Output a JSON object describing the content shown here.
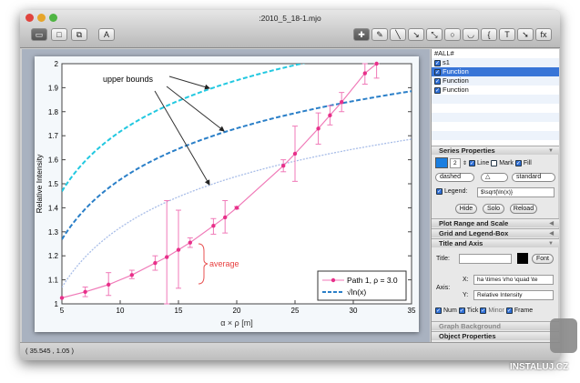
{
  "window": {
    "title": ":2010_5_18-1.mjo"
  },
  "toolbar": {
    "left": [
      {
        "name": "view-page",
        "glyph": "▭"
      },
      {
        "name": "view-graph",
        "glyph": "□"
      },
      {
        "name": "view-layers",
        "glyph": "⧉"
      },
      {
        "name": "font",
        "glyph": "A"
      }
    ],
    "right": [
      {
        "name": "select",
        "glyph": "✚"
      },
      {
        "name": "pencil",
        "glyph": "✎"
      },
      {
        "name": "line",
        "glyph": "╲"
      },
      {
        "name": "arrow",
        "glyph": "↘"
      },
      {
        "name": "double-arrow",
        "glyph": "⤡"
      },
      {
        "name": "circle",
        "glyph": "○"
      },
      {
        "name": "arc",
        "glyph": "◡"
      },
      {
        "name": "brace",
        "glyph": "{"
      },
      {
        "name": "text",
        "glyph": "T"
      },
      {
        "name": "pointer",
        "glyph": "➘"
      },
      {
        "name": "function",
        "glyph": "fx"
      }
    ]
  },
  "series_list": [
    {
      "label": "#ALL#",
      "checkbox": false
    },
    {
      "label": "s1",
      "checkbox": true
    },
    {
      "label": "Function",
      "checkbox": true,
      "selected": true
    },
    {
      "label": "Function",
      "checkbox": true
    },
    {
      "label": "Function",
      "checkbox": true
    }
  ],
  "series_properties": {
    "header": "Series Properties",
    "color": "#1a7ee0",
    "width": "2",
    "line_label": "Line",
    "line": true,
    "mark_label": "Mark",
    "mark": false,
    "fill_label": "Fill",
    "fill": true,
    "style": "dashed",
    "marker": "△",
    "mode": "standard",
    "legend_label": "Legend:",
    "legend_value": "$\\sqrt{\\ln(x)}",
    "hide": "Hide",
    "solo": "Solo",
    "reload": "Reload"
  },
  "sections": {
    "plot_range": "Plot Range and Scale",
    "grid_legend": "Grid and Legend-Box",
    "title_axis": "Title and Axis",
    "graph_background": "Graph Background",
    "object_properties": "Object Properties"
  },
  "title_axis": {
    "title_label": "Title:",
    "title_value": "",
    "font": "Font",
    "axis_label": "Axis:",
    "x_label": "X:",
    "x_value": "ha \\times \\rho \\quad \\te",
    "y_label": "Y:",
    "y_value": "Relative Intensity",
    "num": "Num",
    "tick": "Tick",
    "minor": "Minor",
    "frame": "Frame"
  },
  "status": {
    "coords": "( 35.545 ,  1.05 )"
  },
  "watermark": "INSTALUJ.CZ",
  "chart_data": {
    "type": "line",
    "xlabel": "α × ρ   [m]",
    "ylabel": "Relative Intensity",
    "xlim": [
      5,
      35
    ],
    "ylim": [
      1,
      2
    ],
    "xticks": [
      5,
      10,
      15,
      20,
      25,
      30,
      35
    ],
    "yticks": [
      1,
      1.1,
      1.2,
      1.3,
      1.4,
      1.5,
      1.6,
      1.7,
      1.8,
      1.9,
      2
    ],
    "legend_position": "bottom-right",
    "series": [
      {
        "name": "Path 1, ρ = 3.0",
        "color": "#e8308a",
        "marker": "circle",
        "x": [
          5,
          7,
          9,
          11,
          13,
          14,
          15,
          16,
          18,
          19,
          20,
          24,
          25,
          27,
          28,
          29,
          31,
          32
        ],
        "y": [
          1.025,
          1.05,
          1.08,
          1.12,
          1.17,
          1.195,
          1.225,
          1.255,
          1.325,
          1.36,
          1.4,
          1.575,
          1.625,
          1.73,
          1.785,
          1.84,
          1.96,
          2.0
        ],
        "err_low": [
          null,
          1.03,
          1.035,
          1.105,
          1.14,
          1.0,
          1.065,
          1.235,
          1.29,
          1.295,
          1.395,
          1.55,
          1.51,
          1.665,
          1.745,
          1.8,
          1.915,
          1.94
        ],
        "err_high": [
          null,
          1.07,
          1.13,
          1.14,
          1.2,
          1.43,
          1.39,
          1.275,
          1.355,
          1.43,
          1.405,
          1.6,
          1.74,
          1.795,
          1.825,
          1.88,
          2.0,
          2.0
        ]
      },
      {
        "name": "√ln(x)",
        "color": "#2a7fc8",
        "style": "dashed",
        "function": "sqrt(ln(x))",
        "offset": 0
      },
      {
        "color": "#22c8e0",
        "style": "dashed",
        "function": "sqrt(ln(x)) + 0.2",
        "offset": 0.2
      },
      {
        "color": "#a8bde8",
        "style": "dotted",
        "function": "sqrt(ln(x)) - 0.2",
        "offset": -0.2
      }
    ],
    "annotations": {
      "upper_bounds": "upper bounds",
      "average": "average"
    }
  }
}
